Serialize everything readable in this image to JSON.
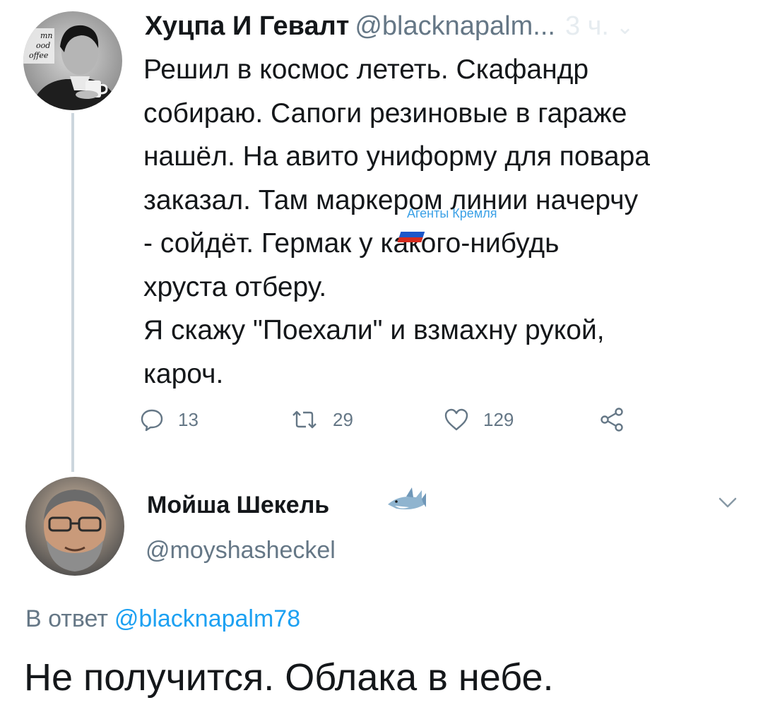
{
  "tweet1": {
    "author_name": "Хуцпа И Гевалт",
    "author_handle": "@blacknapalm...",
    "timestamp": "3 ч.",
    "text_lines": [
      "Решил в космос лететь. Скафандр",
      "собираю. Сапоги резиновые в гараже",
      "нашёл. На авито униформу для повара",
      "заказал. Там маркером линии начерчу",
      "- сойдёт. Гермак у какого-нибудь",
      "хруста отберу.",
      "Я скажу \"Поехали\" и взмахну рукой,",
      "кароч."
    ],
    "overlay_label": "Агенты Кремля",
    "avatar_text": [
      "mn",
      "ood",
      "offee"
    ],
    "actions": {
      "reply_count": "13",
      "retweet_count": "29",
      "like_count": "129"
    }
  },
  "tweet2": {
    "author_name": "Мойша Шекель",
    "author_handle": "@moyshasheckel",
    "reply_prefix": "В ответ",
    "reply_mention": "@blacknapalm78",
    "text": "Не получится. Облака в небе."
  },
  "colors": {
    "primary_text": "#14171a",
    "secondary_text": "#657786",
    "link": "#1da1f2",
    "thread_line": "#ccd6dd"
  },
  "icons": {
    "reply": "speech-bubble-icon",
    "retweet": "retweet-arrows-icon",
    "like": "heart-outline-icon",
    "share": "share-nodes-icon",
    "flag": "russian-flag-emoji",
    "shark": "shark-emoji",
    "caret": "chevron-down-icon"
  }
}
